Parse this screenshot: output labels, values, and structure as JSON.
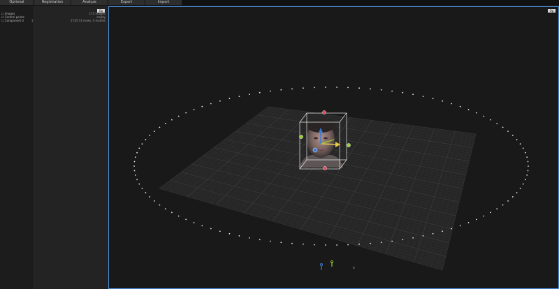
{
  "topbar": {
    "tabs": [
      {
        "label": "Optional"
      },
      {
        "label": "Registration"
      },
      {
        "label": "Analyze"
      },
      {
        "label": "Export"
      },
      {
        "label": "Import"
      }
    ]
  },
  "sidebar": {
    "button_label": "Op",
    "rows": [
      {
        "name": "☐ Images",
        "value": "173 images"
      },
      {
        "name": "☐ Control points",
        "value": "empty"
      },
      {
        "name": "☐ Component 0",
        "marker": "1",
        "value": "173/173 views, 0 models"
      }
    ]
  },
  "viewport": {
    "button_label": "Op"
  },
  "colors": {
    "accent": "#4a90d9",
    "handle_red": "#e04a5a",
    "handle_green": "#9acd32",
    "handle_blue": "#3a7bd5",
    "gizmo_yellow": "#e8c84a"
  }
}
